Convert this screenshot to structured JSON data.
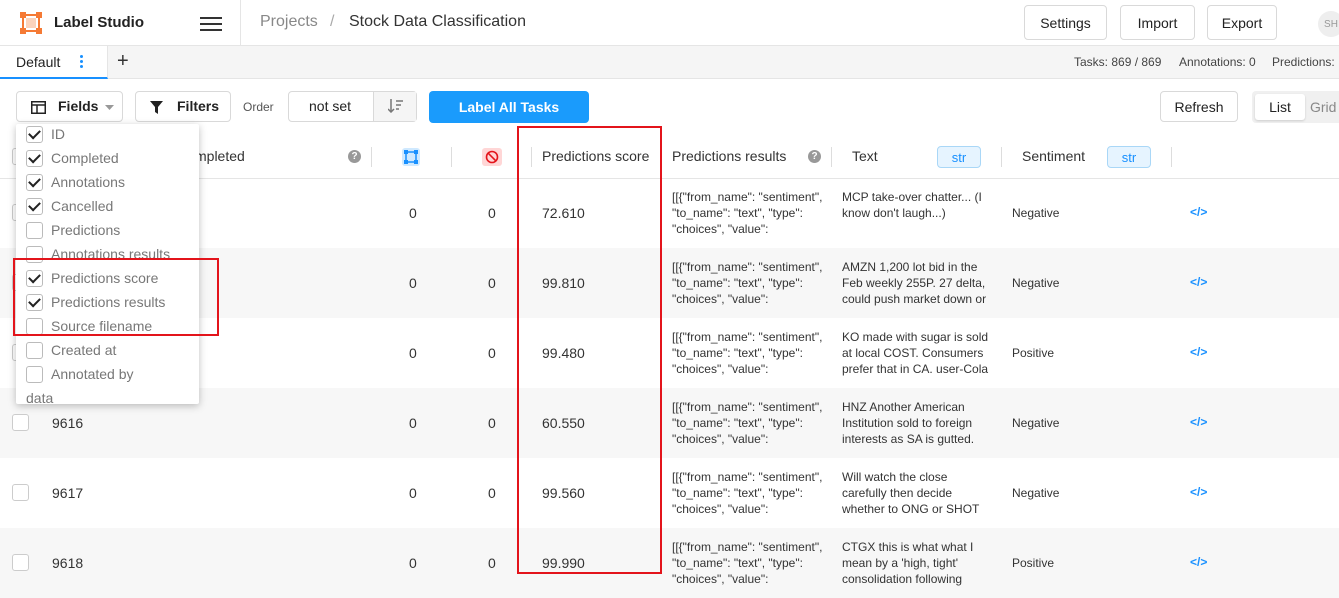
{
  "header": {
    "app_title": "Label Studio",
    "breadcrumb_projects": "Projects",
    "breadcrumb_sep": "/",
    "project_name": "Stock Data Classification",
    "settings_label": "Settings",
    "import_label": "Import",
    "export_label": "Export",
    "avatar_initials": "SH"
  },
  "tabs": {
    "default_tab": "Default",
    "add_symbol": "+"
  },
  "stats": {
    "tasks": "Tasks: 869 / 869",
    "annotations": "Annotations: 0",
    "predictions": "Predictions:"
  },
  "toolbar": {
    "fields_label": "Fields",
    "filters_label": "Filters",
    "order_label": "Order",
    "order_value": "not set",
    "label_all": "Label All Tasks",
    "refresh_label": "Refresh",
    "view_list": "List",
    "view_grid": "Grid"
  },
  "columns": {
    "completed": "mpleted",
    "predictions_score": "Predictions score",
    "predictions_results": "Predictions results",
    "text": "Text",
    "text_type": "str",
    "sentiment": "Sentiment",
    "sentiment_type": "str"
  },
  "fields_menu": [
    {
      "label": "ID",
      "checked": true
    },
    {
      "label": "Completed",
      "checked": true
    },
    {
      "label": "Annotations",
      "checked": true
    },
    {
      "label": "Cancelled",
      "checked": true
    },
    {
      "label": "Predictions",
      "checked": false
    },
    {
      "label": "Annotations results",
      "checked": false
    },
    {
      "label": "Predictions score",
      "checked": true
    },
    {
      "label": "Predictions results",
      "checked": true
    },
    {
      "label": "Source filename",
      "checked": false
    },
    {
      "label": "Created at",
      "checked": false
    },
    {
      "label": "Annotated by",
      "checked": false
    },
    {
      "label": "data",
      "checked": false
    }
  ],
  "rows": [
    {
      "id": "",
      "annotations": "0",
      "cancelled": "0",
      "score": "72.610",
      "pred": [
        "[[{\"from_name\": \"sentiment\",",
        "\"to_name\": \"text\", \"type\":",
        "\"choices\", \"value\":"
      ],
      "text": [
        "MCP take-over chatter... (I",
        "know don't laugh...)"
      ],
      "sentiment": "Negative"
    },
    {
      "id": "",
      "annotations": "0",
      "cancelled": "0",
      "score": "99.810",
      "pred": [
        "[[{\"from_name\": \"sentiment\",",
        "\"to_name\": \"text\", \"type\":",
        "\"choices\", \"value\":"
      ],
      "text": [
        "AMZN 1,200 lot bid in the",
        "Feb weekly 255P. 27 delta,",
        "could push market down or"
      ],
      "sentiment": "Negative"
    },
    {
      "id": "",
      "annotations": "0",
      "cancelled": "0",
      "score": "99.480",
      "pred": [
        "[[{\"from_name\": \"sentiment\",",
        "\"to_name\": \"text\", \"type\":",
        "\"choices\", \"value\":"
      ],
      "text": [
        "KO made with sugar is sold",
        "at local COST. Consumers",
        "prefer that in CA. user-Cola"
      ],
      "sentiment": "Positive"
    },
    {
      "id": "9616",
      "annotations": "0",
      "cancelled": "0",
      "score": "60.550",
      "pred": [
        "[[{\"from_name\": \"sentiment\",",
        "\"to_name\": \"text\", \"type\":",
        "\"choices\", \"value\":"
      ],
      "text": [
        "HNZ Another American",
        "Institution sold to foreign",
        "interests as SA is gutted."
      ],
      "sentiment": "Negative"
    },
    {
      "id": "9617",
      "annotations": "0",
      "cancelled": "0",
      "score": "99.560",
      "pred": [
        "[[{\"from_name\": \"sentiment\",",
        "\"to_name\": \"text\", \"type\":",
        "\"choices\", \"value\":"
      ],
      "text": [
        "Will watch the close",
        "carefully then decide",
        "whether to ONG or SHOT"
      ],
      "sentiment": "Negative"
    },
    {
      "id": "9618",
      "annotations": "0",
      "cancelled": "0",
      "score": "99.990",
      "pred": [
        "[[{\"from_name\": \"sentiment\",",
        "\"to_name\": \"text\", \"type\":",
        "\"choices\", \"value\":"
      ],
      "text": [
        "CTGX this is what what I",
        "mean by a 'high, tight'",
        "consolidation following"
      ],
      "sentiment": "Positive"
    }
  ],
  "colors": {
    "accent": "#1890ff",
    "label_all_bg": "#1a9bfc",
    "highlight": "#e3141b",
    "logo": "#f57a35"
  }
}
